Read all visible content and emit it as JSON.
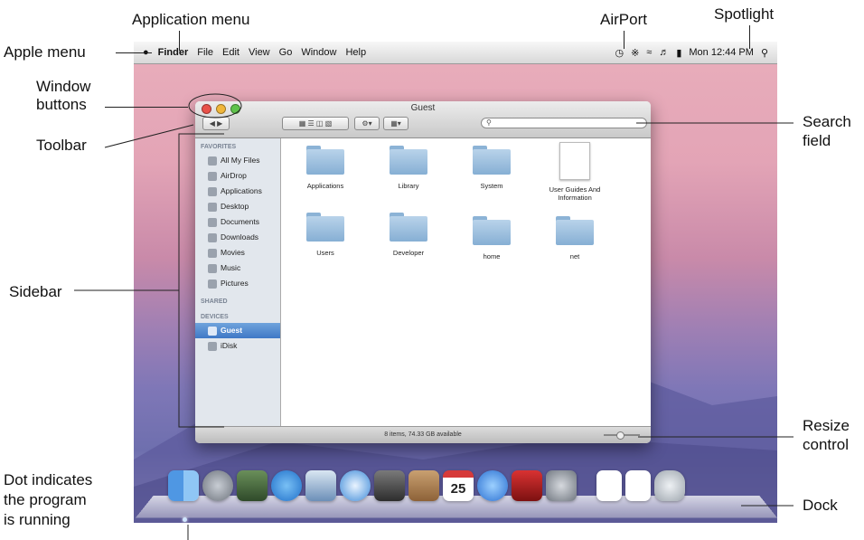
{
  "callouts": {
    "application_menu": "Application menu",
    "airport": "AirPort",
    "spotlight": "Spotlight",
    "apple_menu": "Apple menu",
    "window_buttons_1": "Window",
    "window_buttons_2": "buttons",
    "toolbar": "Toolbar",
    "search_field_1": "Search",
    "search_field_2": "field",
    "sidebar": "Sidebar",
    "resize_control_1": "Resize",
    "resize_control_2": "control",
    "dot_1": "Dot indicates",
    "dot_2": "the program",
    "dot_3": "is running",
    "dock": "Dock"
  },
  "menubar": {
    "apple_icon": "apple-icon",
    "items": [
      "Finder",
      "File",
      "Edit",
      "View",
      "Go",
      "Window",
      "Help"
    ],
    "clock": "Mon 12:44 PM",
    "status_icons": [
      "time-machine-icon",
      "bluetooth-icon",
      "wifi-icon",
      "volume-icon",
      "battery-icon",
      "spotlight-icon"
    ]
  },
  "window": {
    "title": "Guest",
    "search_placeholder": "",
    "status": "8 items, 74.33 GB available"
  },
  "sidebar": {
    "favorites_header": "FAVORITES",
    "favorites": [
      "All My Files",
      "AirDrop",
      "Applications",
      "Desktop",
      "Documents",
      "Downloads",
      "Movies",
      "Music",
      "Pictures"
    ],
    "shared_header": "SHARED",
    "devices_header": "DEVICES",
    "devices": [
      "Guest",
      "iDisk"
    ],
    "selected": "Guest"
  },
  "items": [
    "Applications",
    "Library",
    "System",
    "User Guides And Information",
    "Users",
    "Developer",
    "home",
    "net"
  ],
  "dock": [
    "finder-icon",
    "launchpad-icon",
    "mission-control-icon",
    "app-store-icon",
    "preview-icon",
    "safari-icon",
    "facetime-icon",
    "address-book-icon",
    "ical-icon",
    "itunes-icon",
    "photo-booth-icon",
    "system-preferences-icon",
    "document-icon",
    "document-icon",
    "trash-icon"
  ],
  "dock_ical_date": "25",
  "colors": {
    "selection": "#3f78c6",
    "desktop_top": "#e9aebb",
    "desktop_bottom": "#6e6fae"
  }
}
